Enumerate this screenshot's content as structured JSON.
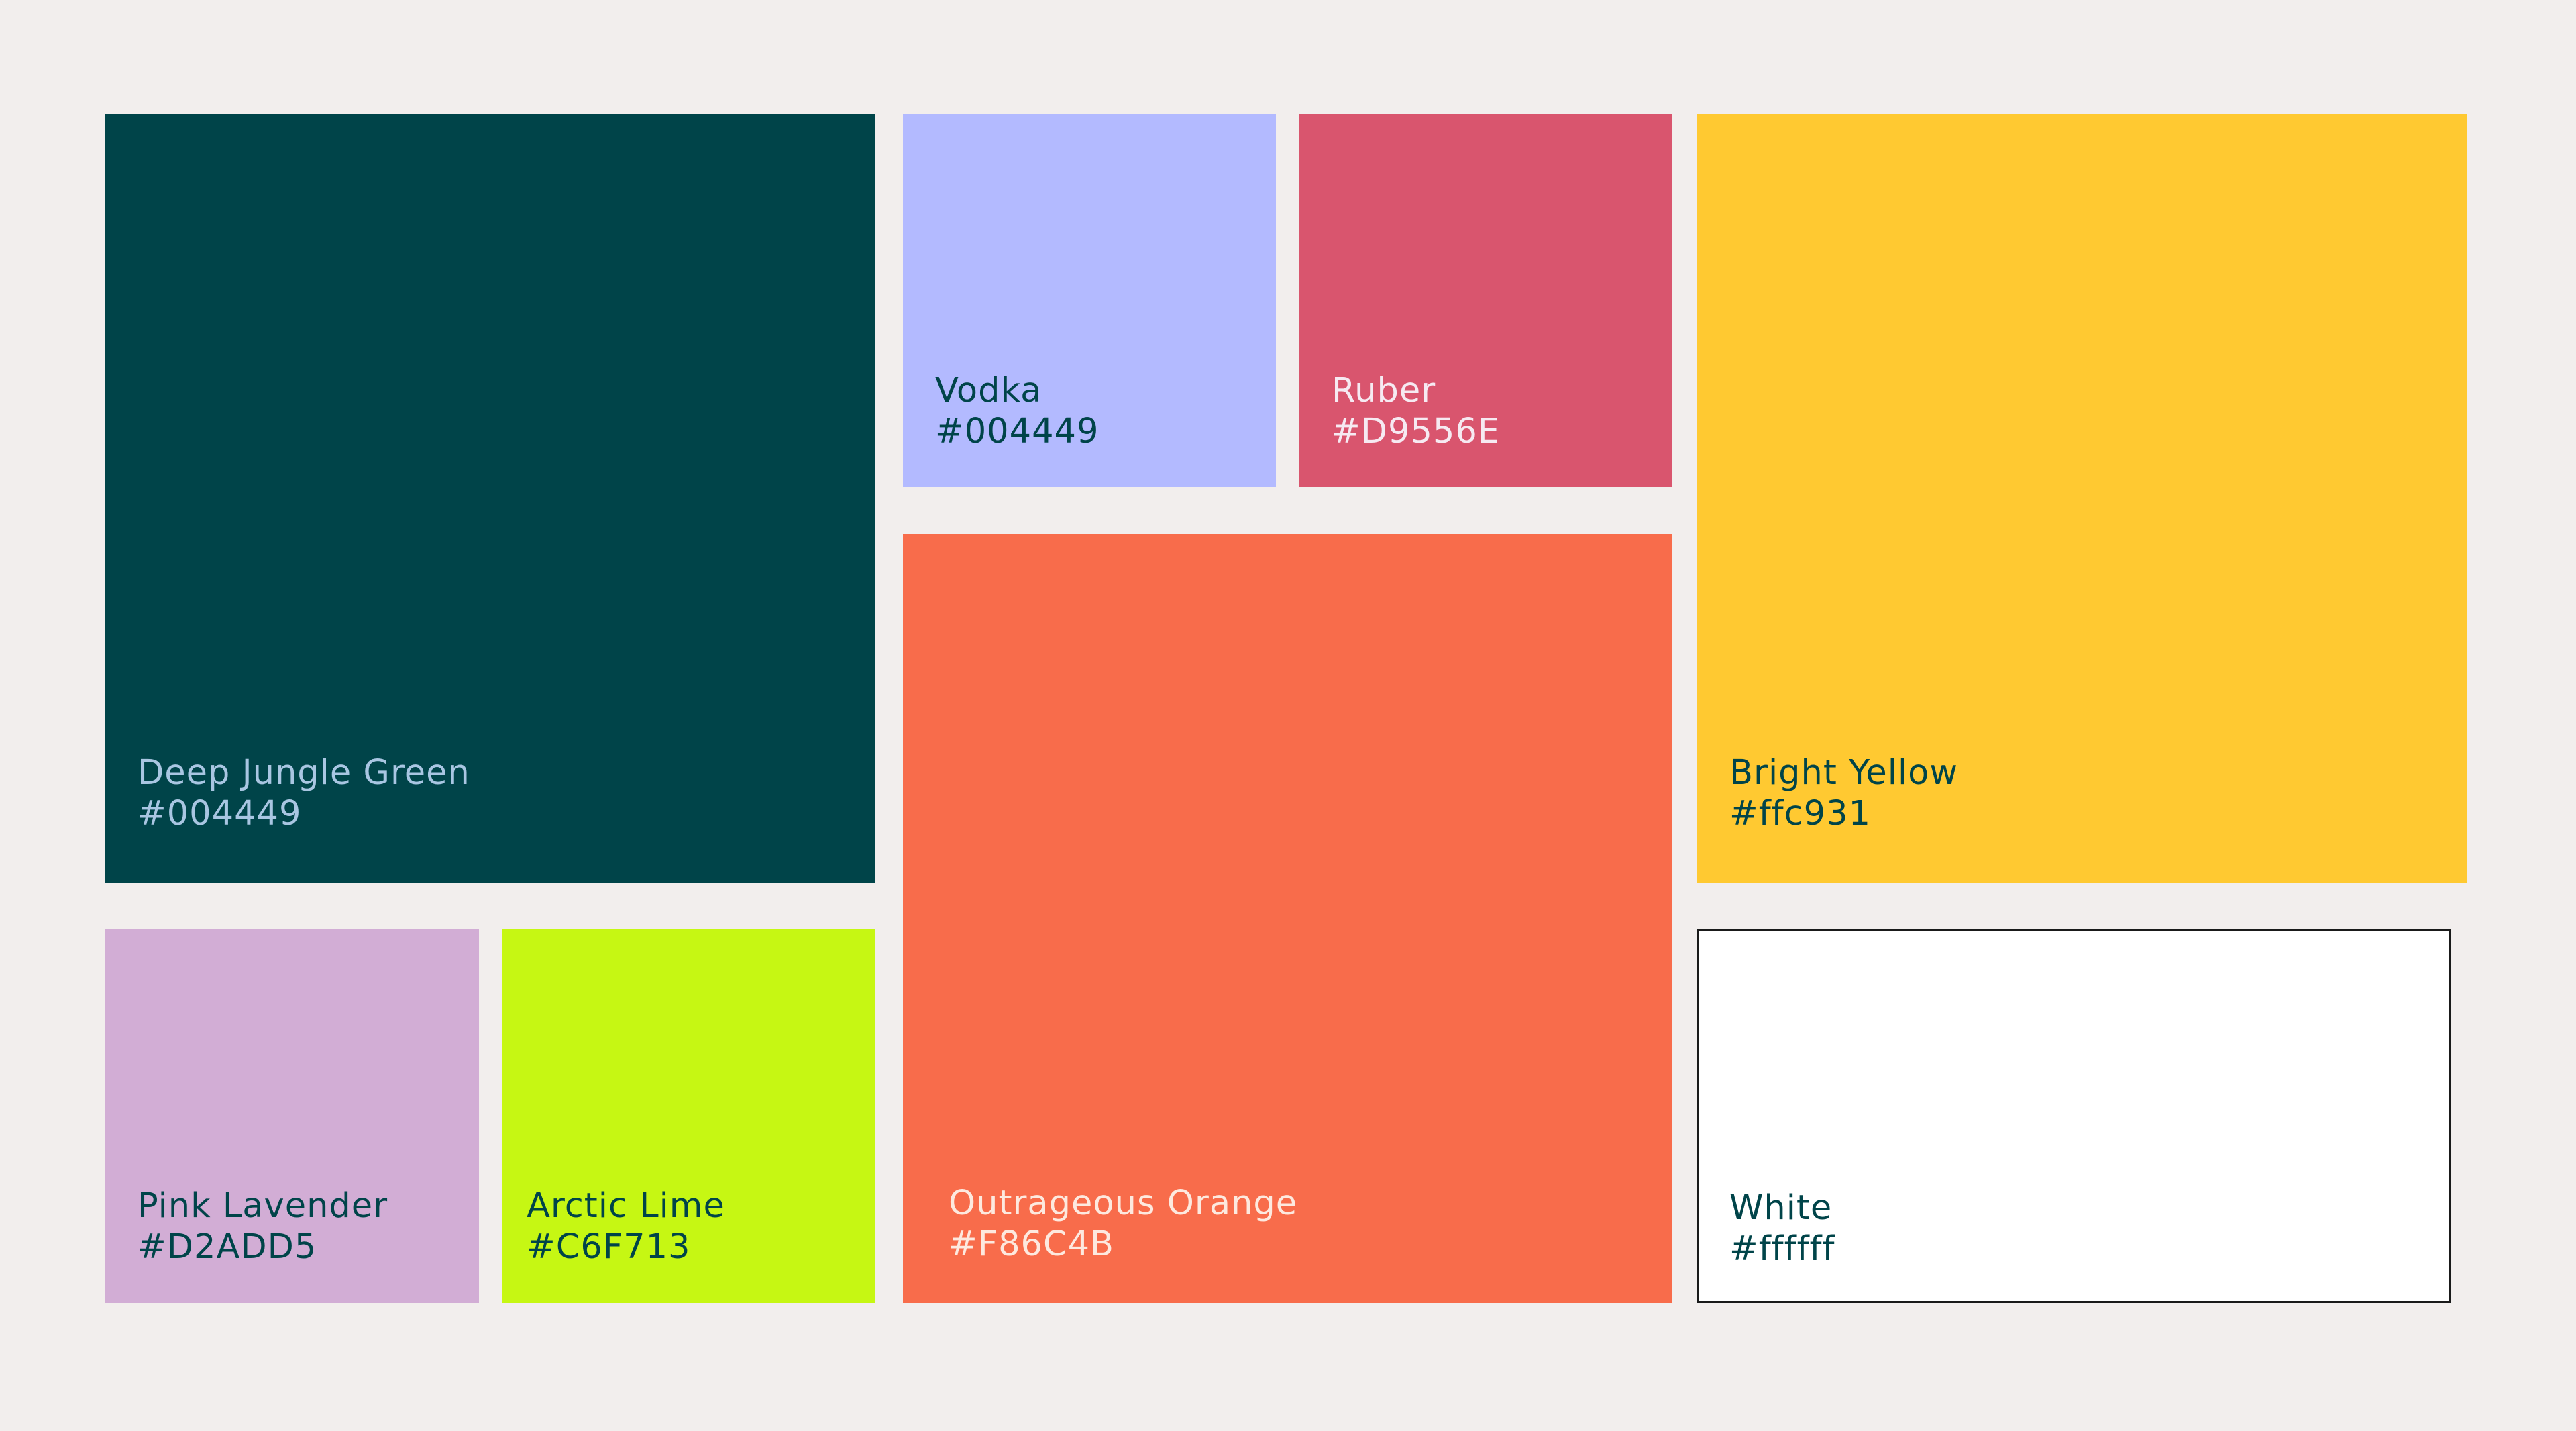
{
  "swatches": [
    {
      "id": "deep-jungle-green",
      "name": "Deep Jungle Green",
      "hex": "#004449",
      "fill": "#004449",
      "text_color": "#a9c6e2"
    },
    {
      "id": "vodka",
      "name": "Vodka",
      "hex": "#004449",
      "fill": "#b3baff",
      "text_color": "#004449"
    },
    {
      "id": "ruber",
      "name": "Ruber",
      "hex": "#D9556E",
      "fill": "#d9556e",
      "text_color": "#f6eaf2"
    },
    {
      "id": "bright-yellow",
      "name": "Bright Yellow",
      "hex": "#ffc931",
      "fill": "#ffc931",
      "text_color": "#004449"
    },
    {
      "id": "pink-lavender",
      "name": "Pink Lavender",
      "hex": "#D2ADD5",
      "fill": "#d2add5",
      "text_color": "#004449"
    },
    {
      "id": "arctic-lime",
      "name": "Arctic Lime",
      "hex": "#C6F713",
      "fill": "#c6f713",
      "text_color": "#004449"
    },
    {
      "id": "outrageous-orange",
      "name": "Outrageous Orange",
      "hex": "#F86C4B",
      "fill": "#f86c4b",
      "text_color": "#fde9df"
    },
    {
      "id": "white",
      "name": "White",
      "hex": "#ffffff",
      "fill": "#ffffff",
      "text_color": "#004449"
    }
  ]
}
